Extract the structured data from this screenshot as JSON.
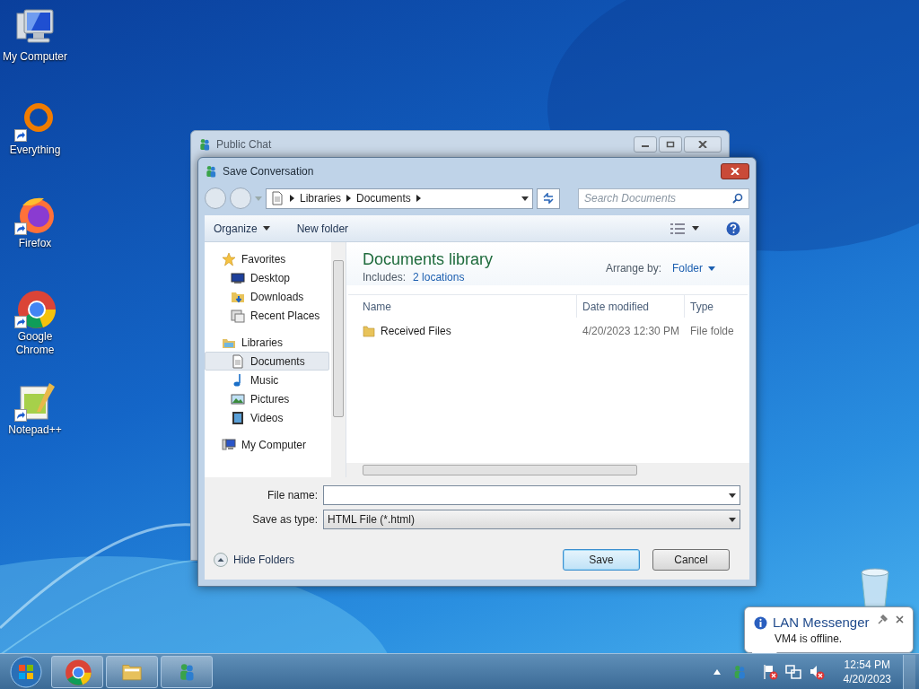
{
  "desktop_icons": [
    {
      "label": "My Computer",
      "kind": "computer",
      "shortcut": false
    },
    {
      "label": "Everything",
      "kind": "ring",
      "shortcut": true
    },
    {
      "label": "Firefox",
      "kind": "firefox",
      "shortcut": true
    },
    {
      "label": "Google Chrome",
      "kind": "chrome",
      "shortcut": true
    },
    {
      "label": "Notepad++",
      "kind": "notepad",
      "shortcut": true
    }
  ],
  "back_window": {
    "title": "Public Chat"
  },
  "dialog": {
    "title": "Save Conversation",
    "breadcrumb": [
      "Libraries",
      "Documents"
    ],
    "search": {
      "placeholder": "Search Documents"
    },
    "toolbar": {
      "organize": "Organize",
      "new_folder": "New folder"
    },
    "nav": [
      {
        "label": "Favorites",
        "kind": "star",
        "selected": false,
        "children": [
          {
            "label": "Desktop",
            "kind": "desktop",
            "selected": false
          },
          {
            "label": "Downloads",
            "kind": "downloads",
            "selected": false
          },
          {
            "label": "Recent Places",
            "kind": "recent",
            "selected": false
          }
        ]
      },
      {
        "label": "Libraries",
        "kind": "libraries",
        "selected": false,
        "children": [
          {
            "label": "Documents",
            "kind": "document",
            "selected": true
          },
          {
            "label": "Music",
            "kind": "music",
            "selected": false
          },
          {
            "label": "Pictures",
            "kind": "pictures",
            "selected": false
          },
          {
            "label": "Videos",
            "kind": "videos",
            "selected": false
          }
        ]
      },
      {
        "label": "My Computer",
        "kind": "computer",
        "selected": false
      }
    ],
    "library": {
      "title": "Documents library",
      "includes_label": "Includes:",
      "includes_link": "2 locations",
      "arrange_label": "Arrange by:",
      "arrange_value": "Folder"
    },
    "columns": [
      "Name",
      "Date modified",
      "Type"
    ],
    "rows": [
      {
        "name": "Received Files",
        "date": "4/20/2023 12:30 PM",
        "type": "File folde"
      }
    ],
    "file_name": {
      "label": "File name:"
    },
    "save_type": {
      "label": "Save as type:",
      "value": "HTML File (*.html)"
    },
    "hide_folders": "Hide Folders",
    "buttons": [
      {
        "label": "Save",
        "kind": "default"
      },
      {
        "label": "Cancel",
        "kind": "normal"
      }
    ]
  },
  "notification": {
    "title": "LAN Messenger",
    "message": "VM4 is offline."
  },
  "taskbar": {
    "apps": [
      {
        "kind": "chrome"
      },
      {
        "kind": "folder"
      },
      {
        "kind": "messenger"
      }
    ],
    "tray": [
      {
        "kind": "flag"
      },
      {
        "kind": "network"
      },
      {
        "kind": "speaker"
      }
    ],
    "time": "12:54 PM",
    "date": "4/20/2023"
  }
}
